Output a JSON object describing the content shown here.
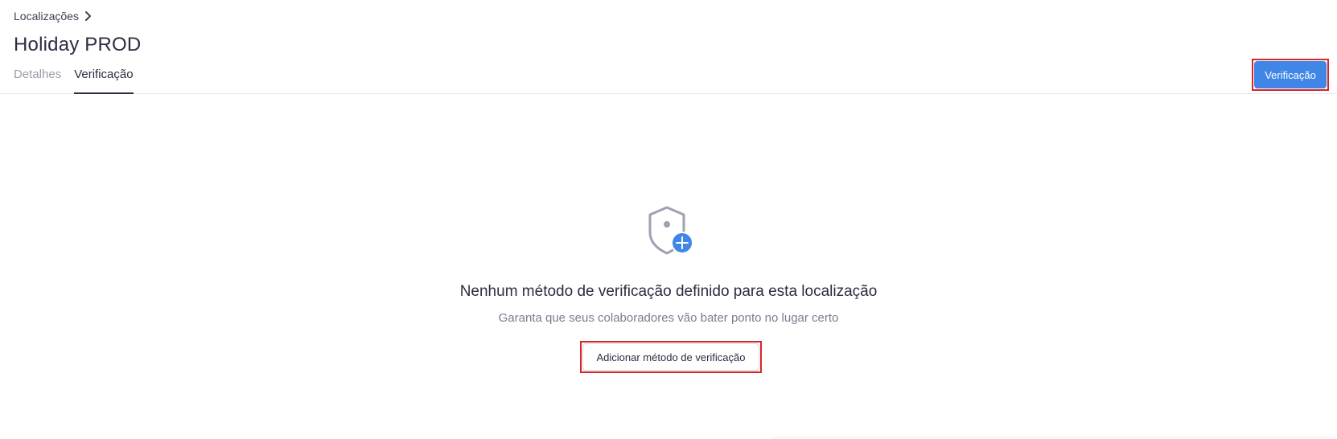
{
  "breadcrumb": {
    "label": "Localizações",
    "icon": "chevron-right-icon"
  },
  "page": {
    "title": "Holiday PROD"
  },
  "tabs": [
    {
      "label": "Detalhes",
      "active": false
    },
    {
      "label": "Verificação",
      "active": true
    }
  ],
  "header_action": {
    "label": "Verificação"
  },
  "empty_state": {
    "icon": "shield-add-icon",
    "title": "Nenhum método de verificação definido para esta localização",
    "subtitle": "Garanta que seus colaboradores vão bater ponto no lugar certo",
    "button_label": "Adicionar método de verificação"
  },
  "colors": {
    "accent": "#3f86e6",
    "text": "#2b2d42",
    "muted": "#9a9cab",
    "highlight": "#d9252a"
  }
}
